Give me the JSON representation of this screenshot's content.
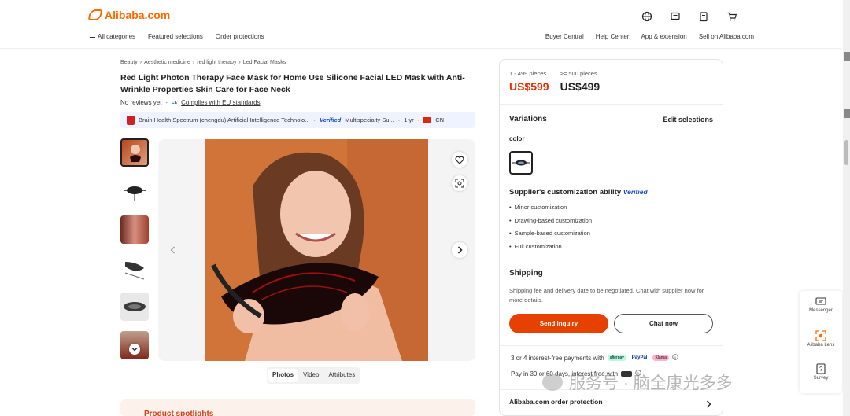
{
  "brand": {
    "name": "Alibaba.com",
    "color": "#ff6a00"
  },
  "top_icons": [
    "globe-icon",
    "message-icon",
    "orders-icon",
    "cart-icon"
  ],
  "nav": {
    "categories": "All categories",
    "featured": "Featured selections",
    "protection": "Order protections",
    "right": [
      "Buyer Central",
      "Help Center",
      "App & extension",
      "Sell on Alibaba.com"
    ]
  },
  "breadcrumb": [
    "Beauty",
    "Aesthetic medicine",
    "red light therapy",
    "Led Facial Masks"
  ],
  "product": {
    "title": "Red Light Photon Therapy Face Mask for Home Use Silicone Facial LED Mask with Anti-Wrinkle Properties Skin Care for Face Neck",
    "reviews": "No reviews yet",
    "separator": "·",
    "ce_mark": "CE",
    "compliance": "Complies with EU standards"
  },
  "supplier": {
    "name": "Brain Health Spectrum (chengdu) Artificial Intelligence Technolo...",
    "verified": "Verified",
    "type": "Multispecialty Su...",
    "years": "1 yr",
    "country": "CN"
  },
  "media_tabs": [
    "Photos",
    "Video",
    "Attributes"
  ],
  "spotlight_title": "Product spotlights",
  "pricing": {
    "tiers": [
      {
        "range": "1 - 499 pieces",
        "price": "US$599",
        "highlight": true
      },
      {
        "range": ">= 500 pieces",
        "price": "US$499",
        "highlight": false
      }
    ]
  },
  "variations": {
    "title": "Variations",
    "edit": "Edit selections",
    "color_label": "color"
  },
  "customization": {
    "title": "Supplier's customization ability",
    "badge": "Verified",
    "items": [
      "Minor customization",
      "Drawing-based customization",
      "Sample-based customization",
      "Full customization"
    ]
  },
  "shipping": {
    "title": "Shipping",
    "desc": "Shipping fee and delivery date to be negotiated. Chat with supplier now for more details."
  },
  "actions": {
    "inquiry": "Send inquiry",
    "chat": "Chat now"
  },
  "payments": {
    "interest_free": "3 or 4 interest-free payments with",
    "badges": [
      "afterpay",
      "PayPal",
      "Klarna"
    ],
    "pay_later": "Pay in 30 or 60 days, interest free with"
  },
  "order_protection": "Alibaba.com order protection",
  "float_bar": {
    "messenger": "Messenger",
    "lens": "Alibaba Lens",
    "survey": "Survey"
  },
  "watermark": "服务号 · 脑全康光多多"
}
